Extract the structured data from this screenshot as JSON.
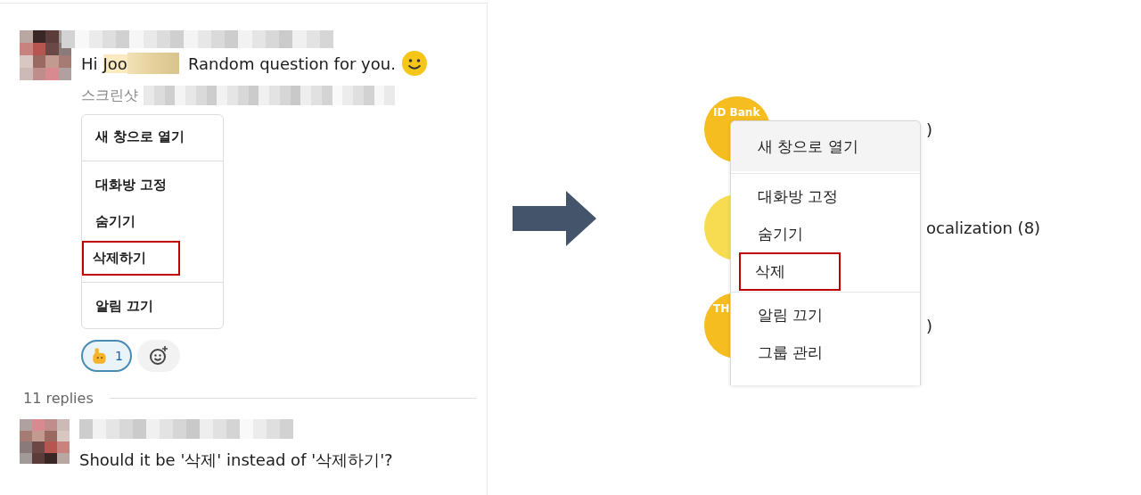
{
  "left_screenshot": {
    "message": {
      "greeting": "Hi",
      "mention": "Joo",
      "text": "Random question for you.",
      "attachment_label": "스크린샷"
    },
    "menu": [
      {
        "label": "새 창으로 열기",
        "kind": "item",
        "selected": false
      },
      {
        "kind": "divider"
      },
      {
        "label": "대화방 고정",
        "kind": "item",
        "selected": false
      },
      {
        "label": "숨기기",
        "kind": "item",
        "selected": false
      },
      {
        "label": "삭제하기",
        "kind": "item",
        "selected": true
      },
      {
        "kind": "divider"
      },
      {
        "label": "알림 끄기",
        "kind": "item",
        "selected": false
      }
    ],
    "reaction_count": "1",
    "replies_label": "11 replies",
    "reply_text": "Should it be '삭제' instead of '삭제하기'?"
  },
  "right_screenshot": {
    "rows": [
      {
        "avatar_text": "ID Bank",
        "title_fragment": ")"
      },
      {
        "avatar_text": "",
        "title_fragment": "ocalization (8)"
      },
      {
        "avatar_text": "TH",
        "title_fragment": ")"
      }
    ],
    "menu": [
      {
        "label": "새 창으로 열기",
        "kind": "item",
        "selected": false,
        "hovered": true
      },
      {
        "kind": "divider"
      },
      {
        "label": "대화방 고정",
        "kind": "item",
        "selected": false,
        "hovered": false
      },
      {
        "label": "숨기기",
        "kind": "item",
        "selected": false,
        "hovered": false
      },
      {
        "label": "삭제",
        "kind": "item",
        "selected": true,
        "hovered": false
      },
      {
        "kind": "divider"
      },
      {
        "label": "알림 끄기",
        "kind": "item",
        "selected": false,
        "hovered": false
      },
      {
        "label": "그룹 관리",
        "kind": "item",
        "selected": false,
        "hovered": false
      }
    ]
  }
}
